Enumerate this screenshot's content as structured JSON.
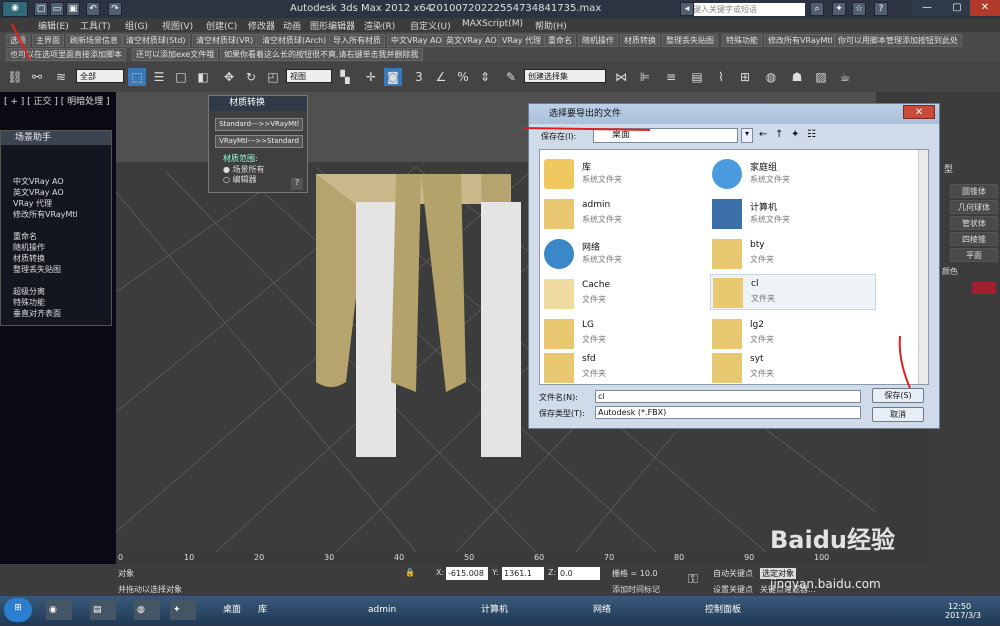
{
  "app": {
    "title": "Autodesk 3ds Max  2012 x64",
    "file": "20100720222554734841735.max",
    "search_placeholder": "键入关键字或短语"
  },
  "menu": [
    "编辑(E)",
    "工具(T)",
    "组(G)",
    "视图(V)",
    "创建(C)",
    "修改器",
    "动画",
    "图形编辑器",
    "渲染(R)",
    "自定义(U)",
    "MAXScript(M)",
    "帮助(H)"
  ],
  "scripts_row1": [
    "选项",
    "主界面",
    "刷新场景信息",
    "清空材质球(Std)",
    "清空材质球(VR)",
    "清空材质球(Arch)",
    "导入所有材质",
    "中文VRay AO",
    "英文VRay AO",
    "VRay 代理",
    "重命名",
    "随机操作",
    "材质转换",
    "整理丢失贴图",
    "特殊功能",
    "修改所有VRayMtl",
    "你可以用脚本管理添加按钮到此处"
  ],
  "scripts_row2": [
    "也可以在选项里面直接添加脚本",
    "还可以添加exe文件哦",
    "如果你看着这么长的按钮很不爽,请右键单击我并删除我"
  ],
  "toolbar": {
    "selection_filter": "全部",
    "view": "视图",
    "named_set": "创建选择集"
  },
  "viewport": {
    "label": "[ + ] [ 正交 ] [ 明暗处理 ]"
  },
  "helper": {
    "title": "场景助手",
    "items": [
      "中文VRay AO",
      "英文VRay AO",
      "VRay 代理",
      "修改所有VRayMtl",
      "重命名",
      "随机操作",
      "材质转换",
      "整理丢失贴图",
      "超级分离",
      "特殊功能",
      "垂直对齐表面"
    ]
  },
  "matconv": {
    "title": "材质转换",
    "btn1": "Standard--->>VRayMtl",
    "btn2": "VRayMtl--->>Standard",
    "range_label": "材质范围:",
    "opt1": "场景所有",
    "opt2": "编辑器",
    "q": "?"
  },
  "rightpanel": {
    "header": "型",
    "items": [
      "圆锥体",
      "几何球体",
      "管状体",
      "四棱锥",
      "平面"
    ],
    "color_label": "颜色"
  },
  "timeline": {
    "ticks": [
      "0",
      "10",
      "20",
      "30",
      "40",
      "50",
      "60",
      "70",
      "80",
      "90",
      "100"
    ]
  },
  "status": {
    "objects": "对象",
    "prompt": "并拖动以选择对象",
    "x_label": "X:",
    "x": "-615.008",
    "y_label": "Y:",
    "y": "1361.1",
    "z_label": "Z:",
    "z": "0.0",
    "grid": "栅格 = 10.0",
    "autokey": "自动关键点",
    "setkey": "设置关键点",
    "selected": "选定对象",
    "addtime": "添加时间标记",
    "key_filter": "关键点过滤器..."
  },
  "taskbar": {
    "items": [
      "桌面",
      "库",
      "admin",
      "计算机",
      "网络",
      "控制面板"
    ],
    "time": "12:50",
    "date": "2017/3/3"
  },
  "watermark": {
    "brand": "Baidu经验",
    "url": "jingyan.baidu.com"
  },
  "dialog": {
    "title": "选择要导出的文件",
    "close": "✕",
    "save_in_label": "保存在(I):",
    "location": "桌面",
    "files": [
      {
        "name": "库",
        "type": "系统文件夹",
        "icon": "library-icon"
      },
      {
        "name": "家庭组",
        "type": "系统文件夹",
        "icon": "homegroup-icon"
      },
      {
        "name": "admin",
        "type": "系统文件夹",
        "icon": "user-folder-icon"
      },
      {
        "name": "计算机",
        "type": "系统文件夹",
        "icon": "computer-icon"
      },
      {
        "name": "网络",
        "type": "系统文件夹",
        "icon": "network-icon"
      },
      {
        "name": "bty",
        "type": "文件夹",
        "icon": "folder-icon"
      },
      {
        "name": "Cache",
        "type": "文件夹",
        "icon": "folder-icon"
      },
      {
        "name": "cl",
        "type": "文件夹",
        "icon": "folder-icon"
      },
      {
        "name": "LG",
        "type": "文件夹",
        "icon": "folder-icon"
      },
      {
        "name": "lg2",
        "type": "文件夹",
        "icon": "folder-icon"
      },
      {
        "name": "sfd",
        "type": "文件夹",
        "icon": "folder-icon"
      },
      {
        "name": "syt",
        "type": "文件夹",
        "icon": "folder-icon"
      }
    ],
    "filename_label": "文件名(N):",
    "filename": "cl",
    "filetype_label": "保存类型(T):",
    "filetype": "Autodesk (*.FBX)",
    "save": "保存(S)",
    "cancel": "取消"
  }
}
